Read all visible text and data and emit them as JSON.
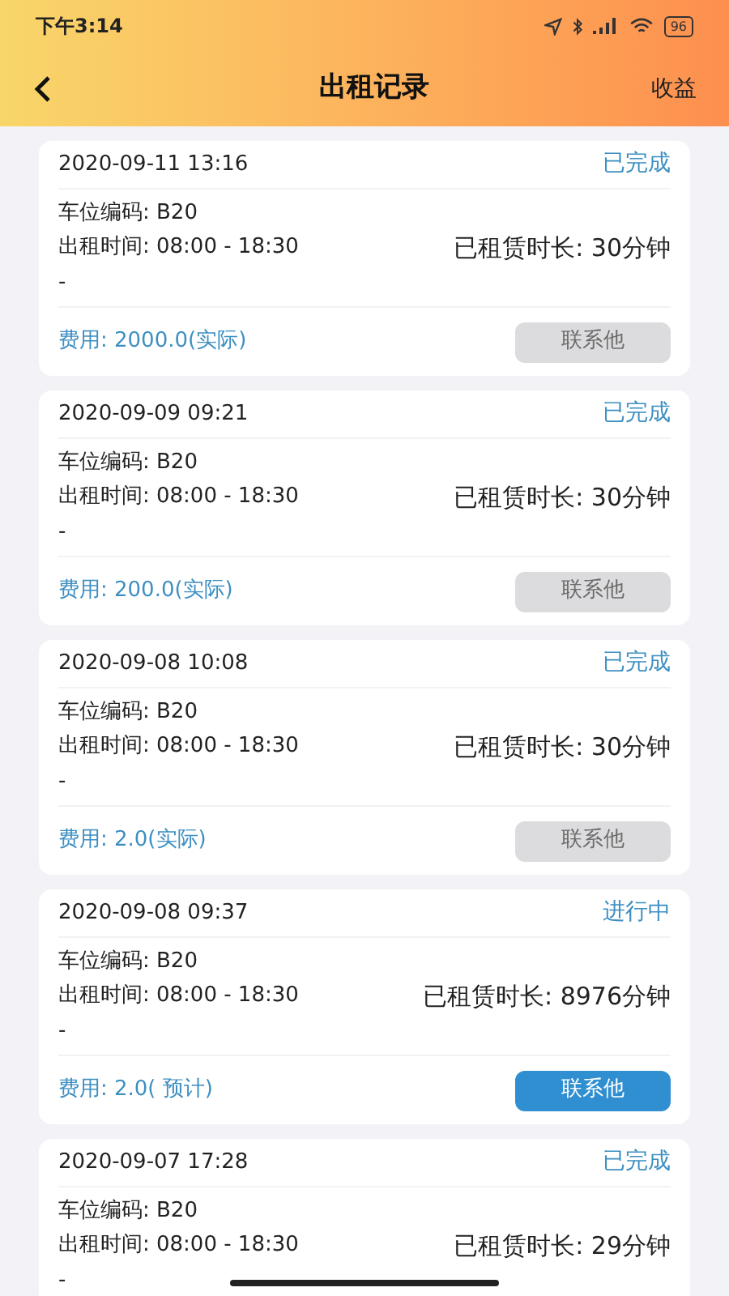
{
  "status_bar": {
    "time": "下午3:14",
    "battery": "96"
  },
  "header": {
    "title": "出租记录",
    "action": "收益"
  },
  "records": [
    {
      "datetime": "2020-09-11 13:16",
      "status": "已完成",
      "spot": "车位编码: B20",
      "period": "出租时间: 08:00 - 18:30",
      "duration": "已租赁时长: 30分钟",
      "note": "-",
      "fee": "费用: 2000.0(实际)",
      "button": "联系他",
      "disabled": true
    },
    {
      "datetime": "2020-09-09 09:21",
      "status": "已完成",
      "spot": "车位编码: B20",
      "period": "出租时间: 08:00 - 18:30",
      "duration": "已租赁时长: 30分钟",
      "note": "-",
      "fee": "费用: 200.0(实际)",
      "button": "联系他",
      "disabled": true
    },
    {
      "datetime": "2020-09-08 10:08",
      "status": "已完成",
      "spot": "车位编码: B20",
      "period": "出租时间: 08:00 - 18:30",
      "duration": "已租赁时长: 30分钟",
      "note": "-",
      "fee": "费用: 2.0(实际)",
      "button": "联系他",
      "disabled": true
    },
    {
      "datetime": "2020-09-08 09:37",
      "status": "进行中",
      "spot": "车位编码: B20",
      "period": "出租时间: 08:00 - 18:30",
      "duration": "已租赁时长: 8976分钟",
      "note": "-",
      "fee": "费用: 2.0( 预计)",
      "button": "联系他",
      "disabled": false
    },
    {
      "datetime": "2020-09-07 17:28",
      "status": "已完成",
      "spot": "车位编码: B20",
      "period": "出租时间: 08:00 - 18:30",
      "duration": "已租赁时长: 29分钟",
      "note": "-"
    }
  ]
}
